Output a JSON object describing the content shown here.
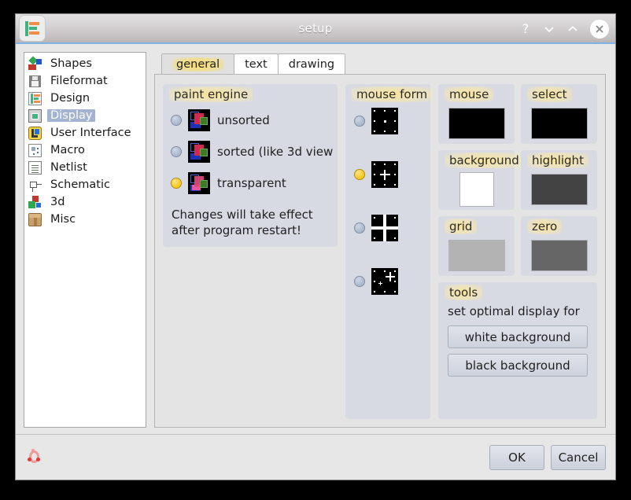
{
  "window": {
    "title": "setup",
    "app_icon": "app-logo-icon",
    "controls": [
      {
        "name": "help-button",
        "glyph": "?"
      },
      {
        "name": "minimize-button",
        "glyph": "∨"
      },
      {
        "name": "maximize-button",
        "glyph": "∧"
      },
      {
        "name": "close-button",
        "glyph": "✕"
      }
    ]
  },
  "sidebar": {
    "items": [
      {
        "label": "Shapes",
        "icon": "shapes-icon",
        "selected": false
      },
      {
        "label": "Fileformat",
        "icon": "fileformat-icon",
        "selected": false
      },
      {
        "label": "Design",
        "icon": "design-icon",
        "selected": false
      },
      {
        "label": "Display",
        "icon": "display-icon",
        "selected": true
      },
      {
        "label": "User Interface",
        "icon": "user-interface-icon",
        "selected": false
      },
      {
        "label": "Macro",
        "icon": "macro-icon",
        "selected": false
      },
      {
        "label": "Netlist",
        "icon": "netlist-icon",
        "selected": false
      },
      {
        "label": "Schematic",
        "icon": "schematic-icon",
        "selected": false
      },
      {
        "label": "3d",
        "icon": "3d-icon",
        "selected": false
      },
      {
        "label": "Misc",
        "icon": "misc-icon",
        "selected": false
      }
    ],
    "selection_color": "#a3b3d2"
  },
  "tabs": [
    {
      "label": "general",
      "active": true
    },
    {
      "label": "text",
      "active": false
    },
    {
      "label": "drawing",
      "active": false
    }
  ],
  "paint_engine": {
    "title": "paint engine",
    "options": [
      {
        "label": "unsorted",
        "selected": false
      },
      {
        "label": "sorted (like 3d view",
        "selected": false
      },
      {
        "label": "transparent",
        "selected": true
      }
    ],
    "note": "Changes will take effect after program restart!"
  },
  "mouse_form": {
    "title": "mouse form",
    "options": [
      {
        "name": "dot-cursor",
        "selected": false
      },
      {
        "name": "small-cross-cursor",
        "selected": true
      },
      {
        "name": "full-cross-cursor",
        "selected": false
      },
      {
        "name": "offset-cross-cursor",
        "selected": false
      }
    ]
  },
  "colors": [
    {
      "title": "mouse",
      "value": "#000000",
      "shape": "wide"
    },
    {
      "title": "select",
      "value": "#000000",
      "shape": "wide"
    },
    {
      "title": "background",
      "value": "#ffffff",
      "shape": "small"
    },
    {
      "title": "highlight",
      "value": "#434343",
      "shape": "wide"
    },
    {
      "title": "grid",
      "value": "#b3b3b3",
      "shape": "wide"
    },
    {
      "title": "zero",
      "value": "#666666",
      "shape": "wide"
    }
  ],
  "tools": {
    "title": "tools",
    "subtitle": "set optimal display for",
    "buttons": [
      {
        "label": "white background"
      },
      {
        "label": "black background"
      }
    ]
  },
  "footer": {
    "icon": "lifebuoy-icon",
    "buttons": [
      {
        "label": "OK",
        "name": "ok-button"
      },
      {
        "label": "Cancel",
        "name": "cancel-button"
      }
    ]
  },
  "theme": {
    "dialog_bg": "#e7e7e7",
    "panel_bg": "#e4e4e4",
    "group_bg": "#d7dae3",
    "accent_selected": "#f5c518"
  }
}
